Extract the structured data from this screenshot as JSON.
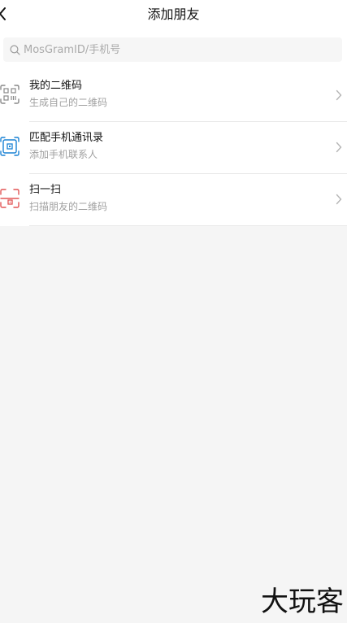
{
  "header": {
    "title": "添加朋友",
    "back_icon": "back-arrow-icon"
  },
  "search": {
    "placeholder": "MosGramID/手机号",
    "value": "",
    "icon": "search-icon"
  },
  "menu": [
    {
      "title": "我的二维码",
      "subtitle": "生成自己的二维码",
      "icon": "qr-code-icon",
      "icon_color": "#888888"
    },
    {
      "title": "匹配手机通讯录",
      "subtitle": "添加手机联系人",
      "icon": "phone-contacts-icon",
      "icon_color": "#1a82d4"
    },
    {
      "title": "扫一扫",
      "subtitle": "扫描朋友的二维码",
      "icon": "scan-icon",
      "icon_color": "#e25555"
    }
  ],
  "watermark": {
    "text": "大玩客"
  }
}
